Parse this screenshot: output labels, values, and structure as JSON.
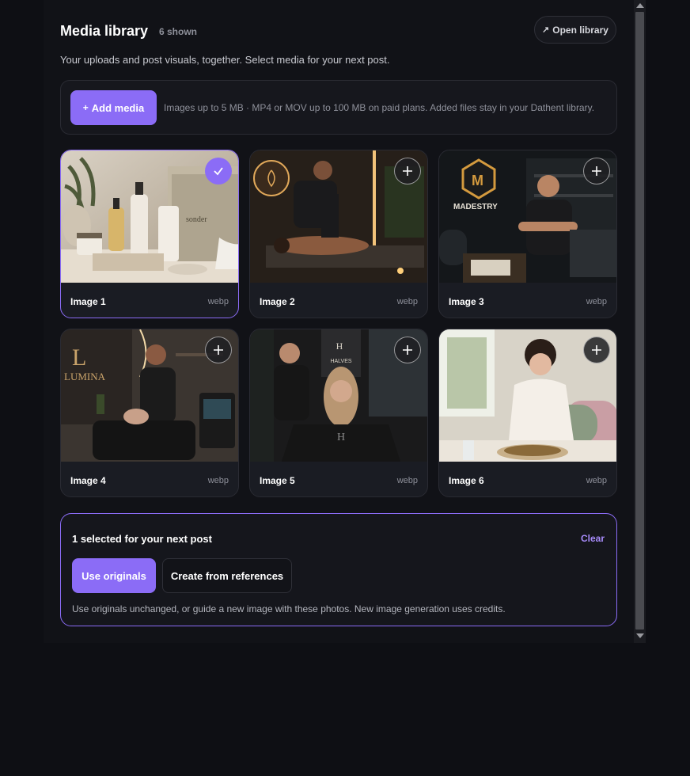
{
  "header": {
    "title": "Media library",
    "count": "6 shown",
    "open_library_label": "Open library",
    "open_library_icon": "external-arrow-icon",
    "subtitle": "Your uploads and post visuals, together. Select media for your next post."
  },
  "upload": {
    "add_label": "Add media",
    "add_icon": "plus-icon",
    "help": "Images up to 5 MB · MP4 or MOV up to 100 MB on paid plans. Added files stay in your Dathent library."
  },
  "media": [
    {
      "label": "Image 1",
      "type": "webp",
      "selected": true
    },
    {
      "label": "Image 2",
      "type": "webp",
      "selected": false
    },
    {
      "label": "Image 3",
      "type": "webp",
      "selected": false
    },
    {
      "label": "Image 4",
      "type": "webp",
      "selected": false
    },
    {
      "label": "Image 5",
      "type": "webp",
      "selected": false
    },
    {
      "label": "Image 6",
      "type": "webp",
      "selected": false
    }
  ],
  "selection": {
    "title": "1 selected for your next post",
    "clear_label": "Clear",
    "use_originals_label": "Use originals",
    "create_from_refs_label": "Create from references",
    "help": "Use originals unchanged, or guide a new image with these photos. New image generation uses credits."
  },
  "colors": {
    "accent": "#8b6cf6",
    "background": "#0e0f14",
    "panel": "#111217"
  }
}
